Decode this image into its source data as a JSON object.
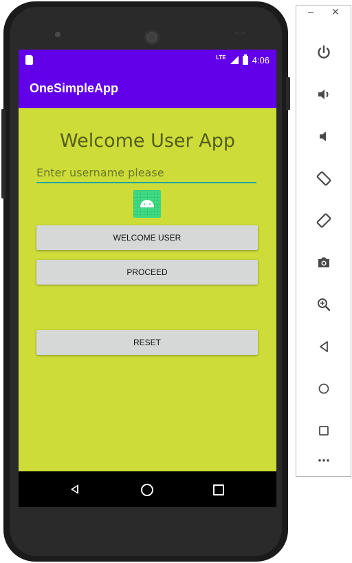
{
  "app": {
    "title": "OneSimpleApp",
    "heading": "Welcome User App",
    "username_placeholder": "Enter username please",
    "buttons": {
      "welcome": "WELCOME USER",
      "proceed": "PROCEED",
      "reset": "RESET"
    }
  },
  "status_bar": {
    "network": "LTE",
    "time": "4:06"
  },
  "nav_bar": {
    "items": [
      "back-icon",
      "home-icon",
      "recents-icon"
    ]
  },
  "emulator_toolbar": {
    "window_controls": [
      "minimize-icon",
      "close-icon"
    ],
    "close_glyph": "✕",
    "items": [
      "power-icon",
      "volume-up-icon",
      "volume-down-icon",
      "rotate-left-icon",
      "rotate-right-icon",
      "camera-icon",
      "zoom-icon",
      "back-icon",
      "home-icon",
      "overview-icon",
      "more-icon"
    ]
  },
  "colors": {
    "primary": "#6200ea",
    "screen_background": "#cddc39",
    "heading_text": "#555f1a",
    "input_underline": "#1aa3a3",
    "button_background": "#d6d7d7",
    "android_logo": "#3ddc84"
  }
}
